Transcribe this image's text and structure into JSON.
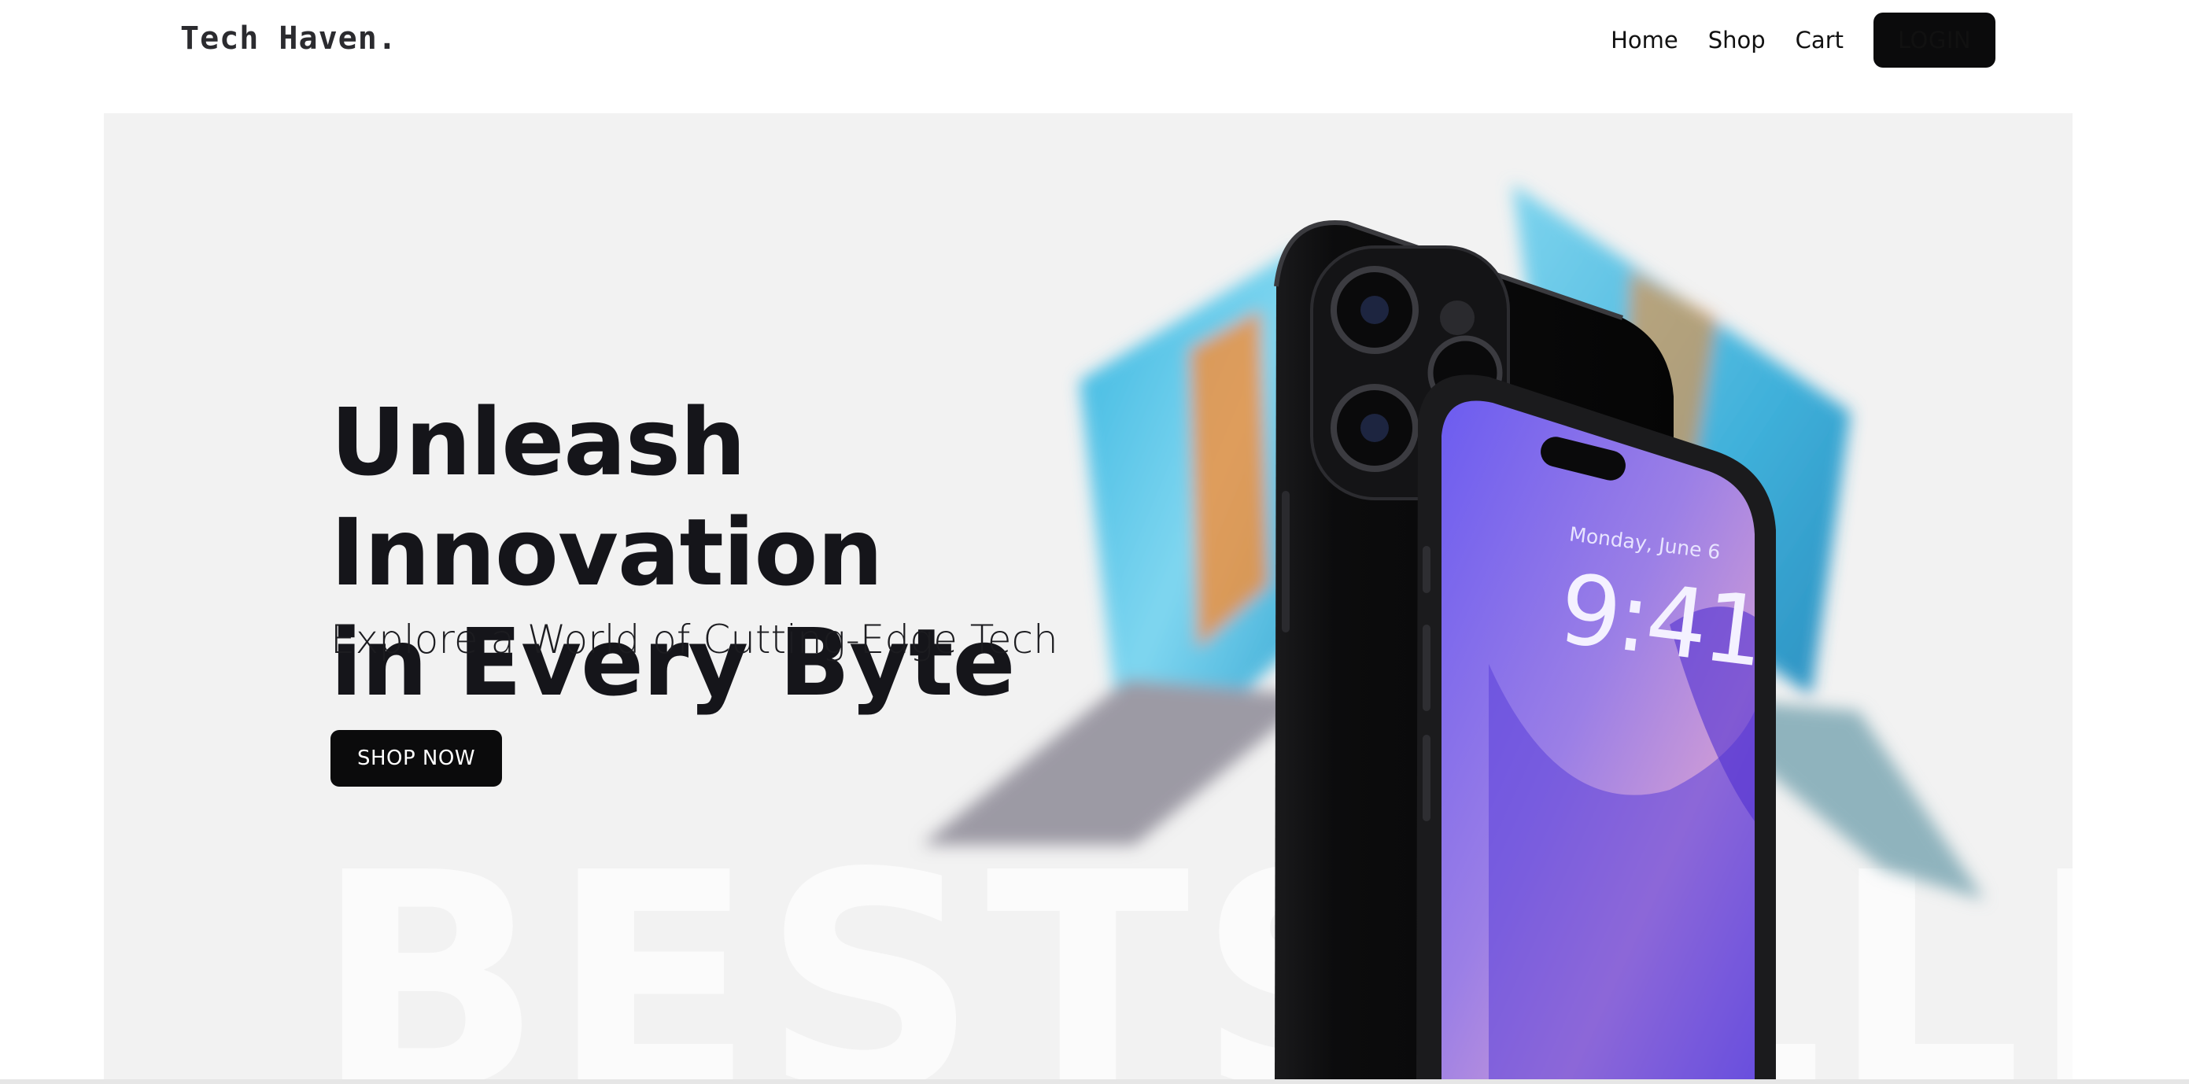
{
  "brand": {
    "name": "Tech Haven."
  },
  "nav": {
    "items": [
      {
        "label": "Home"
      },
      {
        "label": "Shop"
      },
      {
        "label": "Cart"
      }
    ],
    "login_label": "LOGIN"
  },
  "hero": {
    "title_line1": "Unleash Innovation",
    "title_line2": "in Every Byte",
    "subtitle": "Explore a World of Cutting-Edge Tech",
    "cta_label": "SHOP NOW",
    "watermark": "BESTSELLE",
    "phone_date": "Monday, June 6",
    "phone_time": "9:41"
  },
  "colors": {
    "accent": "#0b0b0c",
    "hero_bg": "#f2f2f2",
    "screen_purple": "#6a4de6"
  }
}
